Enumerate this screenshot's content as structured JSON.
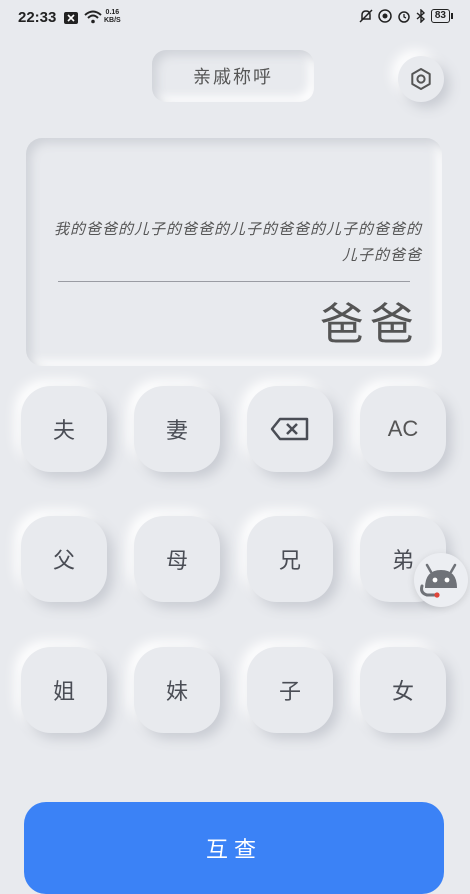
{
  "status_bar": {
    "time": "22:33",
    "net_speed": "0.16",
    "net_unit": "KB/S",
    "battery": "83"
  },
  "header": {
    "title": "亲戚称呼",
    "settings_icon": "gear-hexagon-icon"
  },
  "display": {
    "expression": "我的爸爸的儿子的爸爸的儿子的爸爸的儿子的爸爸的儿子的爸爸",
    "result": "爸爸"
  },
  "keys": {
    "husband": "夫",
    "wife": "妻",
    "backspace_icon": "backspace-icon",
    "clear": "AC",
    "father": "父",
    "mother": "母",
    "elder_brother": "兄",
    "younger_brother": "弟",
    "elder_sister": "姐",
    "younger_sister": "妹",
    "son": "子",
    "daughter": "女"
  },
  "action": {
    "query_label": "互查"
  },
  "colors": {
    "background": "#e8eaee",
    "accent": "#3b82f6"
  }
}
